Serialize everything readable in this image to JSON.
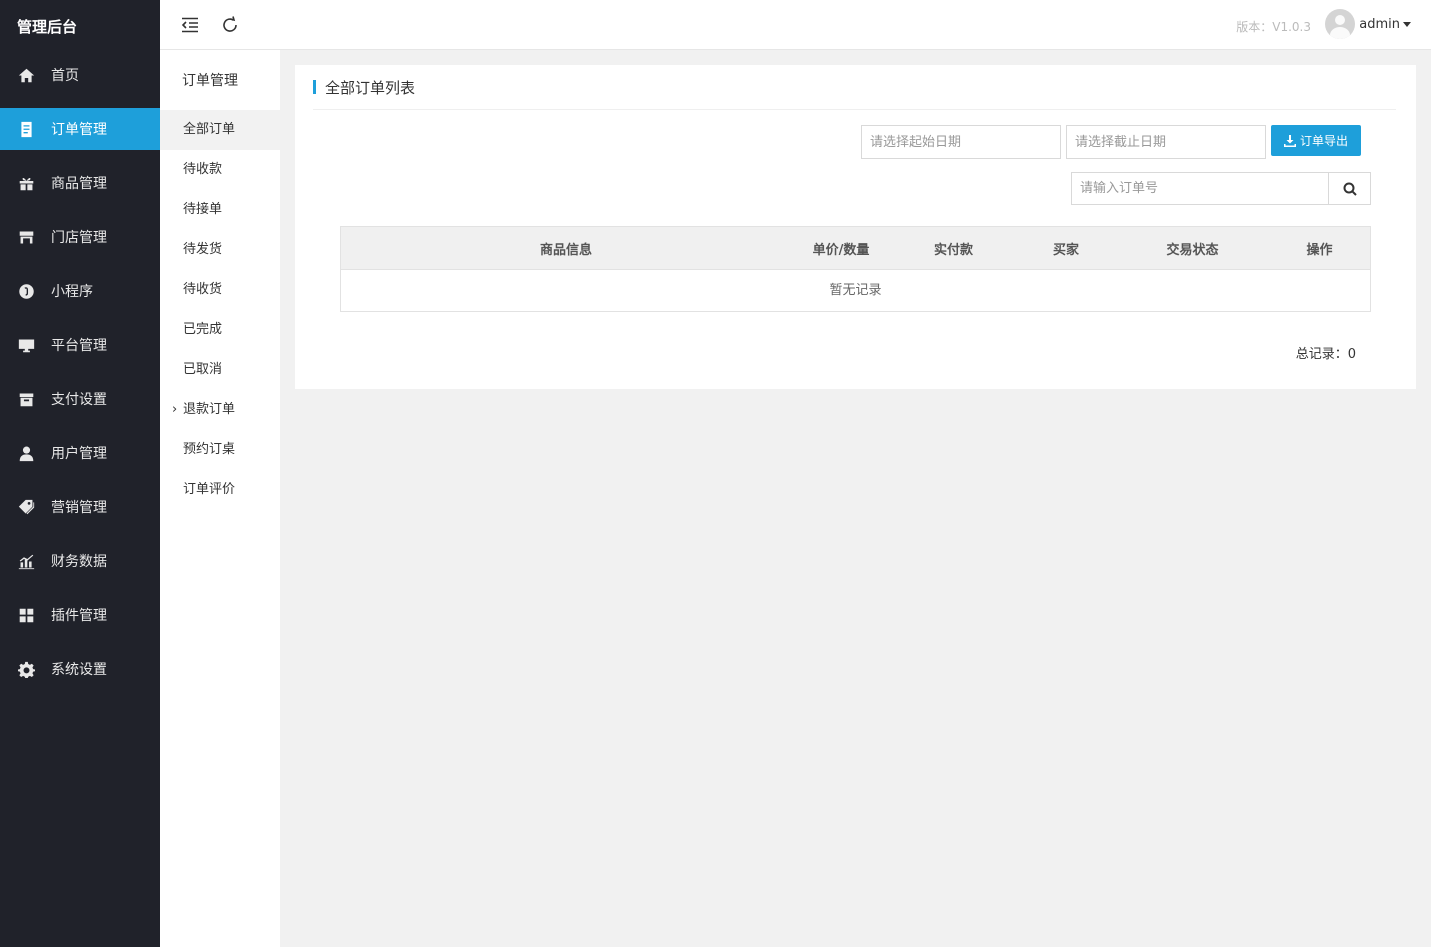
{
  "app": {
    "brand": "管理后台"
  },
  "sidebar": {
    "items": [
      {
        "label": "首页",
        "icon": "home-icon"
      },
      {
        "label": "订单管理",
        "icon": "document-icon",
        "active": true
      },
      {
        "label": "商品管理",
        "icon": "gift-icon"
      },
      {
        "label": "门店管理",
        "icon": "store-icon"
      },
      {
        "label": "小程序",
        "icon": "miniprogram-icon"
      },
      {
        "label": "平台管理",
        "icon": "monitor-icon"
      },
      {
        "label": "支付设置",
        "icon": "archive-icon"
      },
      {
        "label": "用户管理",
        "icon": "user-icon"
      },
      {
        "label": "营销管理",
        "icon": "tags-icon"
      },
      {
        "label": "财务数据",
        "icon": "chart-icon"
      },
      {
        "label": "插件管理",
        "icon": "puzzle-icon"
      },
      {
        "label": "系统设置",
        "icon": "gear-icon"
      }
    ]
  },
  "submenu": {
    "title": "订单管理",
    "items": [
      {
        "label": "全部订单",
        "active": true
      },
      {
        "label": "待收款"
      },
      {
        "label": "待接单"
      },
      {
        "label": "待发货"
      },
      {
        "label": "待收货"
      },
      {
        "label": "已完成"
      },
      {
        "label": "已取消"
      },
      {
        "label": "退款订单",
        "expandable": true
      },
      {
        "label": "预约订桌"
      },
      {
        "label": "订单评价"
      }
    ]
  },
  "header": {
    "version": "版本：V1.0.3",
    "username": "admin"
  },
  "main": {
    "title": "全部订单列表",
    "start_date_placeholder": "请选择起始日期",
    "end_date_placeholder": "请选择截止日期",
    "export_label": "订单导出",
    "search_placeholder": "请输入订单号",
    "table": {
      "columns": [
        "商品信息",
        "单价/数量",
        "实付款",
        "买家",
        "交易状态",
        "操作"
      ],
      "empty_text": "暂无记录"
    },
    "total_label": "总记录：0"
  },
  "colors": {
    "sidebar_bg": "#20222a",
    "accent": "#1e9fda",
    "page_bg": "#f1f1f1"
  }
}
